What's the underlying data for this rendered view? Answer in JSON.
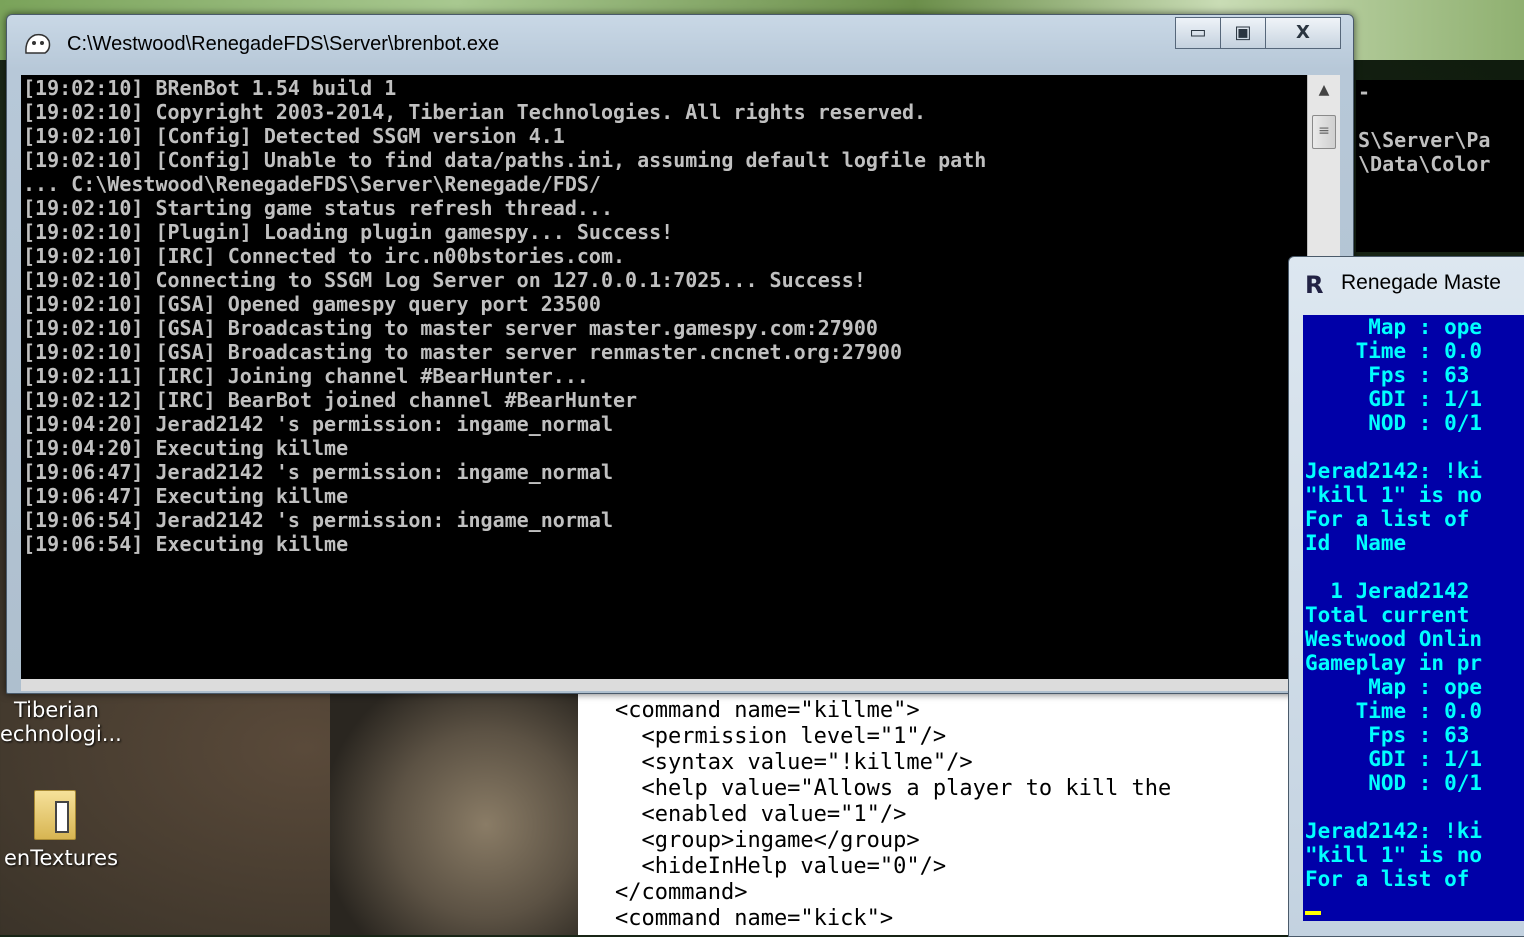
{
  "desktop": {
    "icons": [
      {
        "label_line1": "Tiberian",
        "label_line2": "echnologi..."
      },
      {
        "label": "enTextures"
      }
    ]
  },
  "console_window": {
    "title": "C:\\Westwood\\RenegadeFDS\\Server\\brenbot.exe",
    "buttons": {
      "minimize": "▭",
      "maximize": "▣",
      "close": "X"
    },
    "lines": "[19:02:10] BRenBot 1.54 build 1\n[19:02:10] Copyright 2003-2014, Tiberian Technologies. All rights reserved.\n[19:02:10] [Config] Detected SSGM version 4.1\n[19:02:10] [Config] Unable to find data/paths.ini, assuming default logfile path\n... C:\\Westwood\\RenegadeFDS\\Server\\Renegade/FDS/\n[19:02:10] Starting game status refresh thread...\n[19:02:10] [Plugin] Loading plugin gamespy... Success!\n[19:02:10] [IRC] Connected to irc.n00bstories.com.\n[19:02:10] Connecting to SSGM Log Server on 127.0.0.1:7025... Success!\n[19:02:10] [GSA] Opened gamespy query port 23500\n[19:02:10] [GSA] Broadcasting to master server master.gamespy.com:27900\n[19:02:10] [GSA] Broadcasting to master server renmaster.cncnet.org:27900\n[19:02:11] [IRC] Joining channel #BearHunter...\n[19:02:12] [IRC] BearBot joined channel #BearHunter\n[19:04:20] Jerad2142 's permission: ingame_normal\n[19:04:20] Executing killme\n[19:06:47] Jerad2142 's permission: ingame_normal\n[19:06:47] Executing killme\n[19:06:54] Jerad2142 's permission: ingame_normal\n[19:06:54] Executing killme"
  },
  "background_console": {
    "lines": "-\n\nS\\Server\\Pa\n\\Data\\Color"
  },
  "xml_editor": {
    "lines": "<command name=\"killme\">\n  <permission level=\"1\"/>\n  <syntax value=\"!killme\"/>\n  <help value=\"Allows a player to kill the\n  <enabled value=\"1\"/>\n  <group>ingame</group>\n  <hideInHelp value=\"0\"/>\n</command>\n<command name=\"kick\">"
  },
  "renegade_master": {
    "title": "Renegade Maste",
    "lines": "     Map : ope\n    Time : 0.0\n     Fps : 63\n     GDI : 1/1\n     NOD : 0/1\n\nJerad2142: !ki\n\"kill 1\" is no\nFor a list of\nId  Name\n\n  1 Jerad2142\nTotal current\nWestwood Onlin\nGameplay in pr\n     Map : ope\n    Time : 0.0\n     Fps : 63\n     GDI : 1/1\n     NOD : 0/1\n\nJerad2142: !ki\n\"kill 1\" is no\nFor a list of"
  },
  "colors": {
    "console_bg": "#000000",
    "console_text": "#c0c0c0",
    "master_bg": "#0000a8",
    "master_text": "#00ffff"
  }
}
